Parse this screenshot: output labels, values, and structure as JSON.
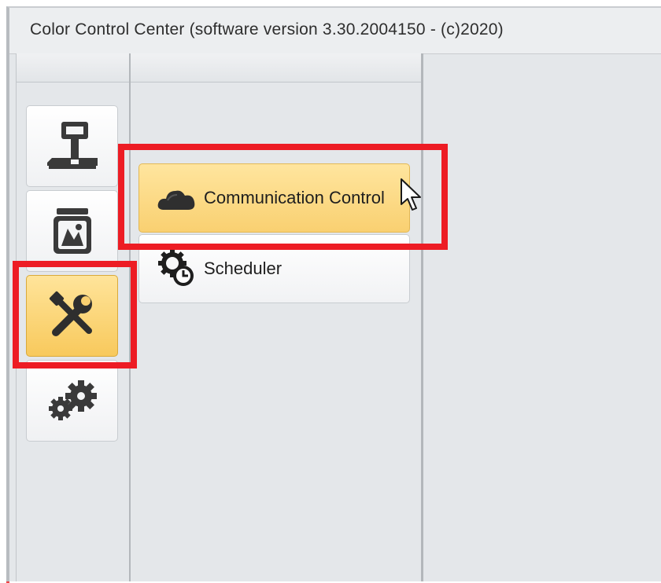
{
  "window": {
    "title": "Color Control Center (software version 3.30.2004150 - (c)2020)"
  },
  "sidebar": {
    "items": [
      {
        "name": "scale",
        "icon": "scale-icon",
        "active": false
      },
      {
        "name": "jar",
        "icon": "jar-icon",
        "active": false
      },
      {
        "name": "tools",
        "icon": "tools-icon",
        "active": true
      },
      {
        "name": "settings",
        "icon": "gears-icon",
        "active": false
      }
    ]
  },
  "submenu": {
    "items": [
      {
        "label": "Communication Control",
        "icon": "cloud-icon",
        "active": true
      },
      {
        "label": "Scheduler",
        "icon": "scheduler-icon",
        "active": false
      }
    ]
  },
  "colors": {
    "active_fill": "#f9d071",
    "highlight": "#ed1c24",
    "panel_bg": "#e4e7ea"
  }
}
